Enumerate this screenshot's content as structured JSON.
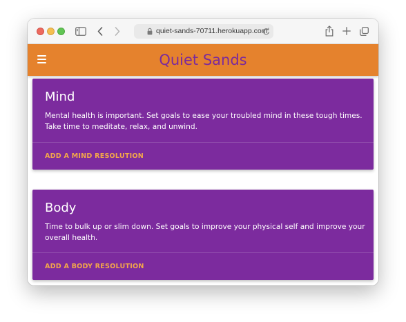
{
  "browser": {
    "url": "quiet-sands-70711.herokuapp.com"
  },
  "header": {
    "title": "Quiet Sands",
    "accent_color": "#e5822d",
    "title_color": "#7b2a9c"
  },
  "cards": [
    {
      "title": "Mind",
      "description": "Mental health is important. Set goals to ease your troubled mind in these tough times. Take time to meditate, relax, and unwind.",
      "action_label": "ADD A MIND RESOLUTION"
    },
    {
      "title": "Body",
      "description": "Time to bulk up or slim down. Set goals to improve your physical self and improve your overall health.",
      "action_label": "ADD A BODY RESOLUTION"
    }
  ],
  "colors": {
    "card_background": "#7c2b9e",
    "action_color": "#f3a74a"
  },
  "icons": [
    "sidebar-icon",
    "back-icon",
    "forward-icon",
    "lock-icon",
    "reload-icon",
    "share-icon",
    "new-tab-icon",
    "tabs-overview-icon",
    "hamburger-menu-icon"
  ]
}
